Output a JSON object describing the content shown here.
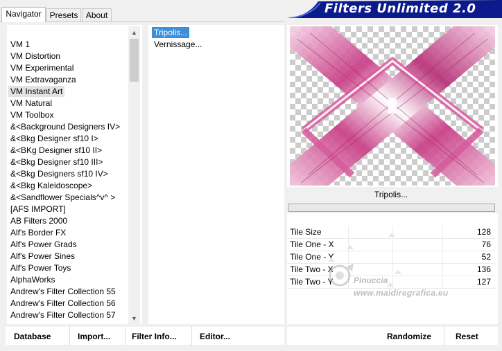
{
  "tabs": [
    {
      "label": "Navigator",
      "active": true
    },
    {
      "label": "Presets",
      "active": false
    },
    {
      "label": "About",
      "active": false
    }
  ],
  "banner": {
    "title": "Filters Unlimited 2.0",
    "color": "#0b1a8c"
  },
  "categories": [
    "VM 1",
    "VM Distortion",
    "VM Experimental",
    "VM Extravaganza",
    "VM Instant Art",
    "VM Natural",
    "VM Toolbox",
    "&<Background Designers IV>",
    "&<Bkg Designer sf10 I>",
    "&<BKg Designer sf10 II>",
    "&<Bkg Designer sf10 III>",
    "&<Bkg Designers sf10 IV>",
    "&<Bkg Kaleidoscope>",
    "&<Sandflower Specials^v^ >",
    "[AFS IMPORT]",
    "AB Filters 2000",
    "Alf's Border FX",
    "Alf's Power Grads",
    "Alf's Power Sines",
    "Alf's Power Toys",
    "AlphaWorks",
    "Andrew's Filter Collection 55",
    "Andrew's Filter Collection 56",
    "Andrew's Filter Collection 57"
  ],
  "selected_category": "VM Instant Art",
  "filters": [
    {
      "label": "Tripolis...",
      "selected": true
    },
    {
      "label": "Vernissage...",
      "selected": false
    }
  ],
  "current_filter": "Tripolis...",
  "params": [
    {
      "label": "Tile Size",
      "value": "128",
      "level": 128
    },
    {
      "label": "Tile One - X",
      "value": "76",
      "level": 76
    },
    {
      "label": "Tile One - Y",
      "value": "52",
      "level": 52
    },
    {
      "label": "Tile Two - X",
      "value": "136",
      "level": 136
    },
    {
      "label": "Tile Two - Y",
      "value": "127",
      "level": 127
    }
  ],
  "watermark": {
    "name": "Pinuccia",
    "site": "www.maidiregrafica.eu"
  },
  "buttons": {
    "database": "Database",
    "import": "Import...",
    "filter_info": "Filter Info...",
    "editor": "Editor...",
    "randomize": "Randomize",
    "reset": "Reset"
  },
  "colors": {
    "accent_selection": "#3b8fd9",
    "preview_pink": "#c83c86",
    "banner": "#0b1a8c"
  }
}
